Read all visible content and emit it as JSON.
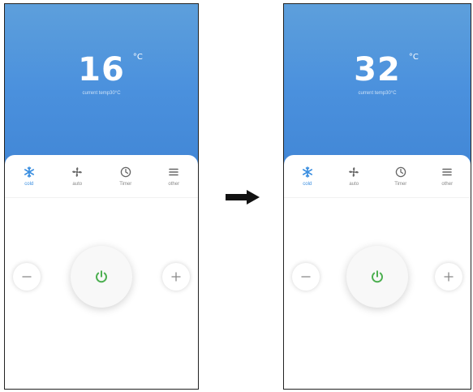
{
  "screens": [
    {
      "temperature": "16",
      "unit": "°C",
      "current_temp": "current temp30°C",
      "modes": [
        {
          "label": "cold",
          "icon": "snowflake-icon",
          "active": true
        },
        {
          "label": "auto",
          "icon": "fan-icon",
          "active": false
        },
        {
          "label": "Timer",
          "icon": "clock-icon",
          "active": false
        },
        {
          "label": "other",
          "icon": "menu-icon",
          "active": false
        }
      ]
    },
    {
      "temperature": "32",
      "unit": "°C",
      "current_temp": "current temp30°C",
      "modes": [
        {
          "label": "cold",
          "icon": "snowflake-icon",
          "active": true
        },
        {
          "label": "auto",
          "icon": "fan-icon",
          "active": false
        },
        {
          "label": "Timer",
          "icon": "clock-icon",
          "active": false
        },
        {
          "label": "other",
          "icon": "menu-icon",
          "active": false
        }
      ]
    }
  ],
  "colors": {
    "header_blue": "#4a90dd",
    "accent_blue": "#3a8ee0",
    "power_green": "#4caf50",
    "icon_gray": "#666666"
  }
}
